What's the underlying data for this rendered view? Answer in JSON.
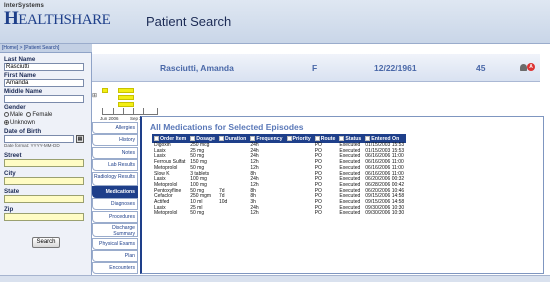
{
  "header": {
    "company": "InterSystems",
    "brand_prefix": "H",
    "brand_rest": "EALTHSHARE",
    "page_title": "Patient Search"
  },
  "breadcrumb": {
    "text": "[Home] > [Patient Search]"
  },
  "search_form": {
    "last_name_label": "Last Name",
    "last_name_value": "Rasciutti",
    "first_name_label": "First Name",
    "first_name_value": "Amanda",
    "middle_name_label": "Middle Name",
    "middle_name_value": "",
    "gender_label": "Gender",
    "gender_male": "Male",
    "gender_female": "Female",
    "gender_unknown": "Unknown",
    "dob_label": "Date of Birth",
    "dob_value": "",
    "date_format_hint": "Date format: YYYY-MM-DD",
    "street_label": "Street",
    "city_label": "City",
    "state_label": "State",
    "zip_label": "Zip",
    "search_button": "Search"
  },
  "patient": {
    "name": "Rasciutti, Amanda",
    "sex": "F",
    "dob": "12/22/1961",
    "age": "45"
  },
  "timeline": {
    "plus": "⊞",
    "start_label": "Jun 2006",
    "end_label": "Sep 2006"
  },
  "tabs": [
    {
      "label": "Allergies",
      "two_line": false
    },
    {
      "label": "History",
      "two_line": false
    },
    {
      "label": "Notes",
      "two_line": false
    },
    {
      "label": "Lab Results",
      "two_line": false
    },
    {
      "label": "Radiology Results",
      "two_line": true
    },
    {
      "label": "Medications",
      "two_line": false,
      "active": true
    },
    {
      "label": "Diagnoses",
      "two_line": false
    },
    {
      "label": "Procedures",
      "two_line": false
    },
    {
      "label": "Discharge Summary",
      "two_line": true
    },
    {
      "label": "Physical Exams",
      "two_line": false
    },
    {
      "label": "Plan",
      "two_line": false
    },
    {
      "label": "Encounters",
      "two_line": false
    }
  ],
  "medications": {
    "title": "All Medications for Selected Episodes",
    "columns": [
      "Order Item",
      "Dosage",
      "Duration",
      "Frequency",
      "Priority",
      "Route",
      "Status",
      "Entered On"
    ],
    "rows": [
      [
        "Digoxin",
        "250 mcg",
        "",
        "24h",
        "",
        "PO",
        "Executed",
        "01/15/2003 15:53"
      ],
      [
        "Lasix",
        "25 mg",
        "",
        "24h",
        "",
        "PO",
        "Executed",
        "01/15/2003 15:53"
      ],
      [
        "Lasix",
        "50 mg",
        "",
        "24h",
        "",
        "PO",
        "Executed",
        "06/16/2006 11:00"
      ],
      [
        "Ferrous Sulfat",
        "150 mg",
        "",
        "12h",
        "",
        "PO",
        "Executed",
        "06/16/2006 11:00"
      ],
      [
        "Metoprolol",
        "50 mg",
        "",
        "12h",
        "",
        "PO",
        "Executed",
        "06/16/2006 11:00"
      ],
      [
        "Slow K",
        "3 tablets",
        "",
        "8h",
        "",
        "PO",
        "Executed",
        "06/16/2006 11:00"
      ],
      [
        "Lasix",
        "100 mg",
        "",
        "24h",
        "",
        "PO",
        "Executed",
        "06/20/2006 00:32"
      ],
      [
        "Metoprolol",
        "100 mg",
        "",
        "12h",
        "",
        "PO",
        "Executed",
        "06/28/2006 00:42"
      ],
      [
        "Pentoxyfline",
        "50 mg",
        "7d",
        "8h",
        "",
        "PO",
        "Executed",
        "06/20/2006 10:46"
      ],
      [
        "Cefaclor",
        "250 mgm",
        "7d",
        "8h",
        "",
        "PO",
        "Executed",
        "09/15/2006 14:58"
      ],
      [
        "Actifed",
        "10 ml",
        "10d",
        "3h",
        "",
        "PO",
        "Executed",
        "09/15/2006 14:58"
      ],
      [
        "Lasix",
        "25 ml",
        "",
        "24h",
        "",
        "PO",
        "Executed",
        "09/30/2006 10:30"
      ],
      [
        "Metoprolol",
        "50 mg",
        "",
        "12h",
        "",
        "PO",
        "Executed",
        "09/30/2006 10:30"
      ]
    ]
  },
  "colors": {
    "accent": "#1e3f8a",
    "field_yellow": "#fffcc4",
    "timeline_bar": "#f2ee14",
    "alert": "#dd3333"
  }
}
